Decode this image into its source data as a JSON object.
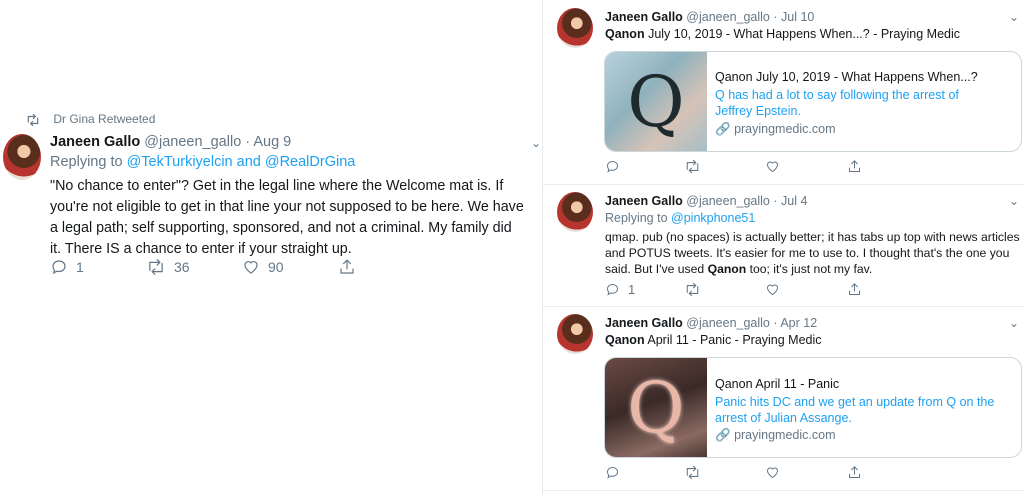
{
  "left_tweet": {
    "retweet_label": "Dr Gina Retweeted",
    "name": "Janeen Gallo",
    "handle": "@janeen_gallo",
    "date": "· Aug 9",
    "replying_prefix": "Replying to",
    "replying_users": "@TekTurkiyelcin and @RealDrGina",
    "body": "\"No chance to enter\"? Get in the legal line where the Welcome mat is. If you're not eligible to get in that line your not supposed to be here. We have a legal path; self supporting, sponsored, and not a criminal. My family did it. There IS a chance to enter if your straight up.",
    "reply_count": "1",
    "retweet_count": "36",
    "like_count": "90"
  },
  "right_tweets": [
    {
      "name": "Janeen Gallo",
      "handle": "@janeen_gallo",
      "date": "· Jul 10",
      "line_bold": "Qanon",
      "line_rest": " July 10, 2019 - What Happens When...? - Praying Medic",
      "card_title": "Qanon July 10, 2019 - What Happens When...?",
      "card_desc": "Q has had a lot to say following the arrest of Jeffrey Epstein.",
      "card_domain": "prayingmedic.com"
    },
    {
      "name": "Janeen Gallo",
      "handle": "@janeen_gallo",
      "date": "· Jul 4",
      "replying_prefix": "Replying to",
      "replying_users": "@pinkphone51",
      "body_1": "qmap. pub (no spaces) is actually better; it has tabs up top with news articles and POTUS tweets. It's easier for me to use to. I thought that's the one you said. But I've used ",
      "body_bold": "Qanon",
      "body_2": " too; it's just not my fav.",
      "reply_count": "1"
    },
    {
      "name": "Janeen Gallo",
      "handle": "@janeen_gallo",
      "date": "· Apr 12",
      "line_bold": "Qanon",
      "line_rest": " April 11 - Panic - Praying Medic",
      "card_title": "Qanon April 11 - Panic",
      "card_desc": "Panic hits DC and we get an update from Q on the arrest of Julian Assange.",
      "card_domain": "prayingmedic.com"
    }
  ],
  "card_image_letter": "Q",
  "colors": {
    "link": "#1da1f2",
    "muted": "#657786",
    "border": "#ccd6dd"
  }
}
